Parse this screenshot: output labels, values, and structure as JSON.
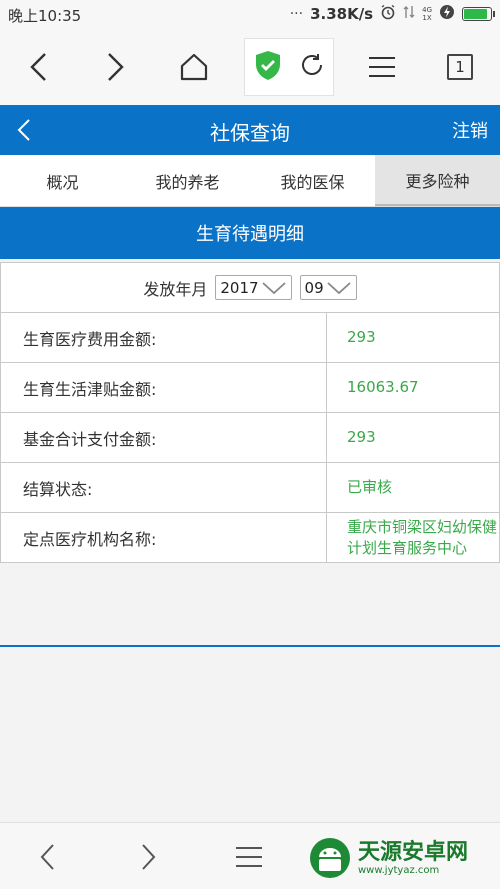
{
  "status_bar": {
    "time": "晚上10:35",
    "net_rate": "3.38K/s",
    "signal_label_top": "4G",
    "signal_label_bottom": "1X",
    "battery_level": 0.9
  },
  "browser": {
    "tab_count": "1"
  },
  "header": {
    "title": "社保查询",
    "logout": "注销"
  },
  "tabs": [
    {
      "label": "概况",
      "active": false
    },
    {
      "label": "我的养老",
      "active": false
    },
    {
      "label": "我的医保",
      "active": false
    },
    {
      "label": "更多险种",
      "active": true
    }
  ],
  "section": {
    "title": "生育待遇明细"
  },
  "filter": {
    "label": "发放年月",
    "year": "2017",
    "month": "09"
  },
  "rows": [
    {
      "label": "生育医疗费用金额:",
      "value": "293"
    },
    {
      "label": "生育生活津贴金额:",
      "value": "16063.67"
    },
    {
      "label": "基金合计支付金额:",
      "value": "293"
    },
    {
      "label": "结算状态:",
      "value": "已审核"
    },
    {
      "label": "定点医疗机构名称:",
      "value": "重庆市铜梁区妇幼保健计划生育服务中心"
    }
  ],
  "watermark": {
    "title": "天源安卓网",
    "url": "www.jytyaz.com"
  },
  "colors": {
    "primary": "#0a73c8",
    "value_green": "#3aa94a",
    "shield_green": "#35b848"
  }
}
